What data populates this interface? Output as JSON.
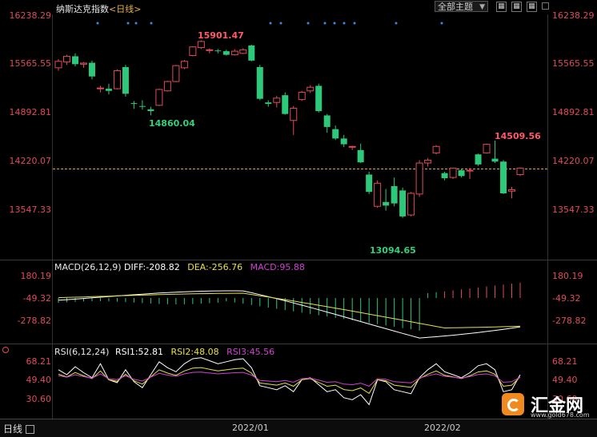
{
  "header": {
    "title": "纳斯达克指数",
    "period": "<日线>",
    "dropdown": "全部主题",
    "btn1": "▦",
    "btn2": "▦",
    "btn3": "▦"
  },
  "price_axis": {
    "left": [
      "16238.29",
      "15565.55",
      "14892.81",
      "14220.07",
      "13547.33"
    ],
    "right": [
      "16238.29",
      "15565.55",
      "14892.81",
      "14220.07",
      "13547.33"
    ]
  },
  "price_labels": {
    "high1": "15901.47",
    "low1": "14860.04",
    "low2": "13094.65",
    "high2": "14509.56"
  },
  "macd": {
    "name": "MACD(26,12,9)",
    "diff": "DIFF:-208.82",
    "dea": "DEA:-256.76",
    "macd": "MACD:95.88",
    "axis": [
      "180.19",
      "-49.32",
      "-278.82"
    ]
  },
  "rsi": {
    "name": "RSI(6,12,24)",
    "rsi1": "RSI1:52.81",
    "rsi2": "RSI2:48.08",
    "rsi3": "RSI3:45.56",
    "axis": [
      "68.21",
      "49.40",
      "30.60"
    ]
  },
  "footer": {
    "period_btn": "日线",
    "dates": [
      "2022/01",
      "2022/02"
    ]
  },
  "logo": {
    "name": "汇金网",
    "url": "www.gold678.com"
  },
  "colors": {
    "up": "#e14a5a",
    "down": "#2dc97a",
    "diff": "#ffffff",
    "dea": "#e6e04a",
    "macd": "#d040d0"
  },
  "candles": [
    [
      15520,
      15640,
      15480,
      15610
    ],
    [
      15600,
      15700,
      15560,
      15680
    ],
    [
      15680,
      15720,
      15540,
      15570
    ],
    [
      15570,
      15600,
      15520,
      15585
    ],
    [
      15590,
      15620,
      15360,
      15400
    ],
    [
      15240,
      15270,
      15180,
      15240
    ],
    [
      15230,
      15300,
      15150,
      15200
    ],
    [
      15230,
      15500,
      15220,
      15480
    ],
    [
      15530,
      15560,
      15120,
      15160
    ],
    [
      15030,
      15060,
      14950,
      15020
    ],
    [
      14990,
      15070,
      14940,
      14985
    ],
    [
      14945,
      14980,
      14860,
      14920
    ],
    [
      15000,
      15230,
      14990,
      15220
    ],
    [
      15200,
      15340,
      15190,
      15330
    ],
    [
      15330,
      15560,
      15320,
      15550
    ],
    [
      15520,
      15630,
      15500,
      15610
    ],
    [
      15690,
      15820,
      15680,
      15810
    ],
    [
      15800,
      15900,
      15780,
      15885
    ],
    [
      15760,
      15790,
      15720,
      15770
    ],
    [
      15760,
      15780,
      15720,
      15750
    ],
    [
      15750,
      15770,
      15690,
      15700
    ],
    [
      15700,
      15780,
      15690,
      15750
    ],
    [
      15720,
      15790,
      15710,
      15770
    ],
    [
      15830,
      15840,
      15610,
      15620
    ],
    [
      15530,
      15560,
      15070,
      15090
    ],
    [
      15040,
      15070,
      14980,
      15020
    ],
    [
      15040,
      15130,
      14970,
      15100
    ],
    [
      15140,
      15180,
      14870,
      14880
    ],
    [
      14790,
      14990,
      14590,
      14960
    ],
    [
      15080,
      15200,
      15060,
      15180
    ],
    [
      15200,
      15280,
      15170,
      15250
    ],
    [
      15270,
      15300,
      14900,
      14920
    ],
    [
      14860,
      14880,
      14620,
      14700
    ],
    [
      14670,
      14720,
      14520,
      14540
    ],
    [
      14540,
      14590,
      14420,
      14460
    ],
    [
      14420,
      14440,
      14380,
      14430
    ],
    [
      14380,
      14470,
      14200,
      14210
    ],
    [
      14040,
      14080,
      13770,
      13800
    ],
    [
      13600,
      13960,
      13580,
      13920
    ],
    [
      13660,
      13840,
      13540,
      13610
    ],
    [
      13880,
      14000,
      13600,
      13640
    ],
    [
      13820,
      13860,
      13440,
      13460
    ],
    [
      13480,
      13800,
      13460,
      13780
    ],
    [
      13770,
      14240,
      13730,
      14200
    ],
    [
      14200,
      14270,
      14150,
      14240
    ],
    [
      14340,
      14450,
      14320,
      14430
    ],
    [
      14060,
      14080,
      13960,
      13990
    ],
    [
      14000,
      14120,
      13980,
      14130
    ],
    [
      14100,
      14120,
      14000,
      14020
    ],
    [
      14100,
      14130,
      13980,
      14100
    ],
    [
      14320,
      14330,
      14160,
      14180
    ],
    [
      14340,
      14470,
      14330,
      14460
    ],
    [
      14260,
      14510,
      14200,
      14220
    ],
    [
      14220,
      14240,
      13770,
      13780
    ],
    [
      13810,
      13870,
      13710,
      13830
    ],
    [
      14040,
      14140,
      14020,
      14130
    ]
  ]
}
